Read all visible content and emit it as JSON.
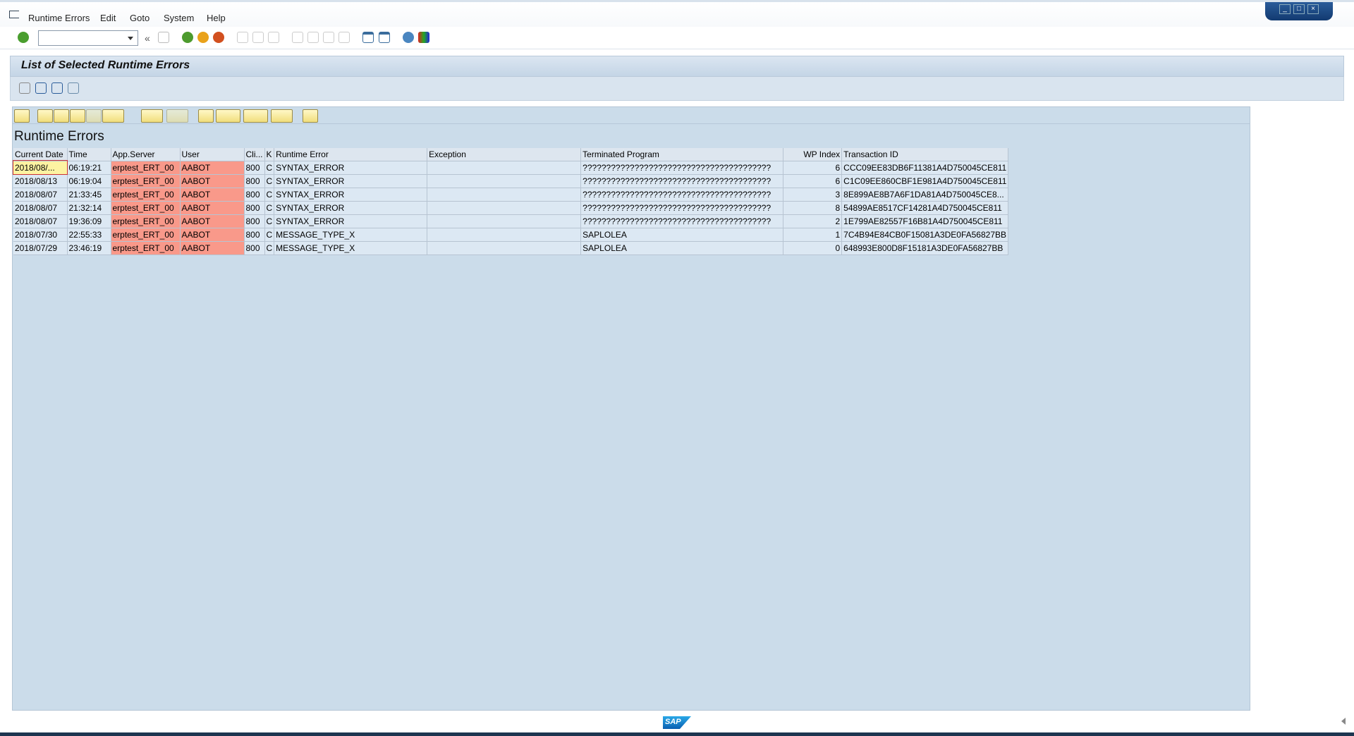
{
  "menu": [
    "Runtime Errors",
    "Edit",
    "Goto",
    "System",
    "Help"
  ],
  "command_field": {
    "value": ""
  },
  "title": "List of Selected Runtime Errors",
  "grid_title": "Runtime Errors",
  "columns": [
    "Current Date",
    "Time",
    "App.Server",
    "User",
    "Cli...",
    "K",
    "Runtime Error",
    "Exception",
    "Terminated Program",
    "WP Index",
    "Transaction ID"
  ],
  "rows": [
    [
      "2018/08/...",
      "06:19:21",
      "erptest_ERT_00",
      "AABOT",
      "800",
      "C",
      "SYNTAX_ERROR",
      "",
      "????????????????????????????????????????",
      "6",
      "CCC09EE83DB6F11381A4D750045CE811"
    ],
    [
      "2018/08/13",
      "06:19:04",
      "erptest_ERT_00",
      "AABOT",
      "800",
      "C",
      "SYNTAX_ERROR",
      "",
      "????????????????????????????????????????",
      "6",
      "C1C09EE860CBF1E981A4D750045CE811"
    ],
    [
      "2018/08/07",
      "21:33:45",
      "erptest_ERT_00",
      "AABOT",
      "800",
      "C",
      "SYNTAX_ERROR",
      "",
      "????????????????????????????????????????",
      "3",
      "8E899AE8B7A6F1DA81A4D750045CE8..."
    ],
    [
      "2018/08/07",
      "21:32:14",
      "erptest_ERT_00",
      "AABOT",
      "800",
      "C",
      "SYNTAX_ERROR",
      "",
      "????????????????????????????????????????",
      "8",
      "54899AE8517CF14281A4D750045CE811"
    ],
    [
      "2018/08/07",
      "19:36:09",
      "erptest_ERT_00",
      "AABOT",
      "800",
      "C",
      "SYNTAX_ERROR",
      "",
      "????????????????????????????????????????",
      "2",
      "1E799AE82557F16B81A4D750045CE811"
    ],
    [
      "2018/07/30",
      "22:55:33",
      "erptest_ERT_00",
      "AABOT",
      "800",
      "C",
      "MESSAGE_TYPE_X",
      "",
      "SAPLOLEA",
      "1",
      "7C4B94E84CB0F15081A3DE0FA56827BB"
    ],
    [
      "2018/07/29",
      "23:46:19",
      "erptest_ERT_00",
      "AABOT",
      "800",
      "C",
      "MESSAGE_TYPE_X",
      "",
      "SAPLOLEA",
      "0",
      "648993E800D8F15181A3DE0FA56827BB"
    ]
  ],
  "colors": {
    "highlight_cell": "#f9998a",
    "selected_cell": "#fdf3a2",
    "grid_bg": "#cbdcea"
  },
  "logo": "SAP"
}
